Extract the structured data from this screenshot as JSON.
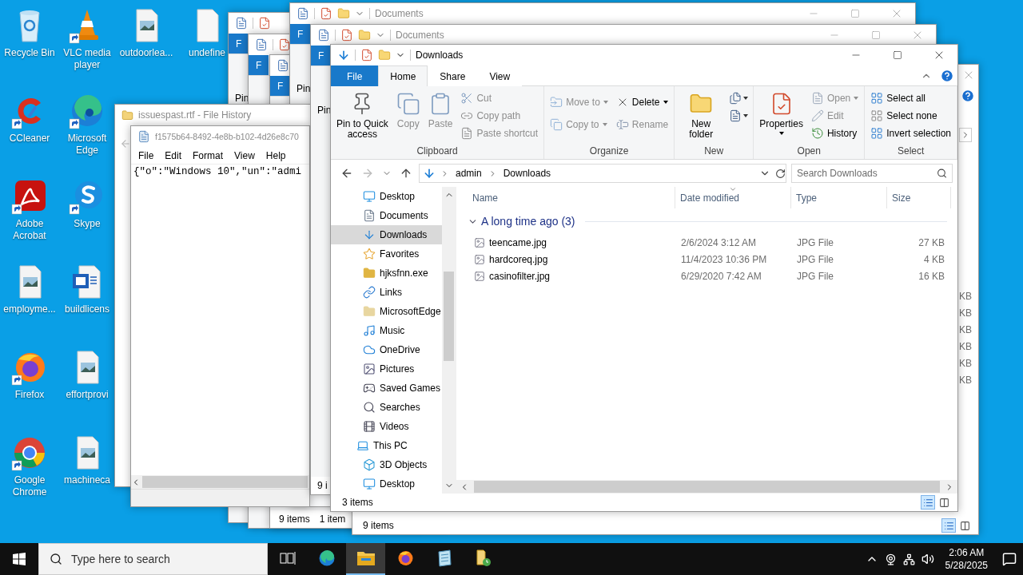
{
  "desktop": {
    "columns": [
      [
        {
          "label": "Recycle Bin",
          "kind": "recycle",
          "shortcut": false
        },
        {
          "label": "CCleaner",
          "kind": "ccleaner",
          "shortcut": true
        },
        {
          "label": "Adobe Acrobat",
          "kind": "acrobat",
          "shortcut": true
        },
        {
          "label": "employme...",
          "kind": "image",
          "shortcut": false
        },
        {
          "label": "Firefox",
          "kind": "firefox",
          "shortcut": true
        },
        {
          "label": "Google Chrome",
          "kind": "chrome",
          "shortcut": true
        }
      ],
      [
        {
          "label": "VLC media player",
          "kind": "vlc",
          "shortcut": true
        },
        {
          "label": "Microsoft Edge",
          "kind": "edge",
          "shortcut": true
        },
        {
          "label": "Skype",
          "kind": "skype",
          "shortcut": true
        },
        {
          "label": "buildlicens",
          "kind": "word",
          "shortcut": false
        },
        {
          "label": "effortprovi",
          "kind": "image",
          "shortcut": false
        },
        {
          "label": "machineca",
          "kind": "image",
          "shortcut": false
        }
      ],
      [
        {
          "label": "outdoorlea...",
          "kind": "image",
          "shortcut": false
        }
      ],
      [
        {
          "label": "undefine",
          "kind": "blank",
          "shortcut": false
        }
      ]
    ]
  },
  "back_windows": [
    {
      "file_tab": "F",
      "pin": "Pin"
    },
    {
      "file_tab": "F"
    },
    {
      "file_tab": "F",
      "status": [
        "9 items",
        "1 item"
      ]
    },
    {
      "title": "Documents",
      "file_tab": "F",
      "pin": "Pin"
    }
  ],
  "file_history": {
    "title": "issuespast.rtf - File History",
    "notepad": {
      "title": "f1575b64-8492-4e8b-b102-4d26e8c70",
      "menu": [
        "File",
        "Edit",
        "Format",
        "View",
        "Help"
      ],
      "text": "{\"o\":\"Windows 10\",\"un\":\"admi"
    }
  },
  "documents_window": {
    "title": "Documents",
    "file_tab": "F",
    "pin": "Pin",
    "status": "9 i"
  },
  "behind_window": {
    "sizes": [
      "KB",
      "KB",
      "KB",
      "KB",
      "KB",
      "KB"
    ],
    "status": "9 items"
  },
  "explorer": {
    "title": "Downloads",
    "tabs": [
      {
        "label": "File",
        "kind": "file",
        "selected": false
      },
      {
        "label": "Home",
        "kind": "tab",
        "selected": true
      },
      {
        "label": "Share",
        "kind": "tab",
        "selected": false
      },
      {
        "label": "View",
        "kind": "tab",
        "selected": false
      }
    ],
    "ribbon": [
      {
        "label": "Clipboard",
        "items": [
          {
            "kind": "large",
            "label": "Pin to Quick access",
            "disabled": false,
            "dropdown": false
          },
          {
            "kind": "large",
            "label": "Copy",
            "disabled": true,
            "dropdown": false
          },
          {
            "kind": "large",
            "label": "Paste",
            "disabled": true,
            "dropdown": false
          },
          {
            "kind": "small",
            "label": "Cut",
            "disabled": true,
            "dropdown": false
          },
          {
            "kind": "small",
            "label": "Copy path",
            "disabled": true,
            "dropdown": false
          },
          {
            "kind": "small",
            "label": "Paste shortcut",
            "disabled": true,
            "dropdown": false
          }
        ]
      },
      {
        "label": "Organize",
        "items": [
          {
            "kind": "medium",
            "label": "Move to",
            "disabled": true,
            "dropdown": true
          },
          {
            "kind": "medium",
            "label": "Copy to",
            "disabled": true,
            "dropdown": true
          },
          {
            "kind": "medium",
            "label": "Delete",
            "disabled": false,
            "dropdown": true
          },
          {
            "kind": "medium",
            "label": "Rename",
            "disabled": true,
            "dropdown": false
          }
        ]
      },
      {
        "label": "New",
        "items": [
          {
            "kind": "large",
            "label": "New folder",
            "disabled": false,
            "dropdown": false
          },
          {
            "kind": "icon",
            "disabled": false,
            "dropdown": true
          },
          {
            "kind": "icon",
            "disabled": false,
            "dropdown": true
          }
        ]
      },
      {
        "label": "Open",
        "items": [
          {
            "kind": "large",
            "label": "Properties",
            "disabled": false,
            "dropdown": true
          },
          {
            "kind": "small",
            "label": "Open",
            "disabled": true,
            "dropdown": true
          },
          {
            "kind": "small",
            "label": "Edit",
            "disabled": true,
            "dropdown": false
          },
          {
            "kind": "small",
            "label": "History",
            "disabled": false,
            "dropdown": false
          }
        ]
      },
      {
        "label": "Select",
        "items": [
          {
            "kind": "small",
            "label": "Select all",
            "disabled": false,
            "dropdown": false
          },
          {
            "kind": "small",
            "label": "Select none",
            "disabled": false,
            "dropdown": false
          },
          {
            "kind": "small",
            "label": "Invert selection",
            "disabled": false,
            "dropdown": false
          }
        ]
      }
    ],
    "path": [
      "admin",
      "Downloads"
    ],
    "search": {
      "placeholder": "Search Downloads"
    },
    "navigation": {
      "folders": [
        {
          "label": "Desktop",
          "selected": false
        },
        {
          "label": "Documents",
          "selected": false
        },
        {
          "label": "Downloads",
          "selected": true
        },
        {
          "label": "Favorites",
          "selected": false
        },
        {
          "label": "hjksfnn.exe",
          "selected": false
        },
        {
          "label": "Links",
          "selected": false
        },
        {
          "label": "MicrosoftEdge",
          "selected": false
        },
        {
          "label": "Music",
          "selected": false
        },
        {
          "label": "OneDrive",
          "selected": false
        },
        {
          "label": "Pictures",
          "selected": false
        },
        {
          "label": "Saved Games",
          "selected": false
        },
        {
          "label": "Searches",
          "selected": false
        },
        {
          "label": "Videos",
          "selected": false
        }
      ],
      "this_pc": {
        "label": "This PC",
        "selected": false,
        "children": [
          {
            "label": "3D Objects",
            "selected": false
          },
          {
            "label": "Desktop",
            "selected": false
          }
        ]
      }
    },
    "columns": [
      {
        "label": "Name",
        "sorted": false
      },
      {
        "label": "Date modified",
        "sorted": true
      },
      {
        "label": "Type",
        "sorted": false
      },
      {
        "label": "Size",
        "sorted": false
      }
    ],
    "group": {
      "label": "A long time ago (3)",
      "expanded": true
    },
    "rows": [
      {
        "name": "teencame.jpg",
        "date": "2/6/2024 3:12 AM",
        "type": "JPG File",
        "size": "27 KB"
      },
      {
        "name": "hardcoreq.jpg",
        "date": "11/4/2023 10:36 PM",
        "type": "JPG File",
        "size": "4 KB"
      },
      {
        "name": "casinofilter.jpg",
        "date": "6/29/2020 7:42 AM",
        "type": "JPG File",
        "size": "16 KB"
      }
    ],
    "status": "3 items"
  },
  "taskbar": {
    "search": {
      "placeholder": "Type here to search"
    },
    "apps": [
      {
        "kind": "task-view",
        "selected": false
      },
      {
        "kind": "edge",
        "selected": false
      },
      {
        "kind": "explorer",
        "selected": true
      },
      {
        "kind": "firefox",
        "selected": false
      },
      {
        "kind": "notepad",
        "selected": false
      },
      {
        "kind": "file-history",
        "selected": false
      }
    ],
    "time": "2:06 AM",
    "date": "5/28/2025"
  }
}
